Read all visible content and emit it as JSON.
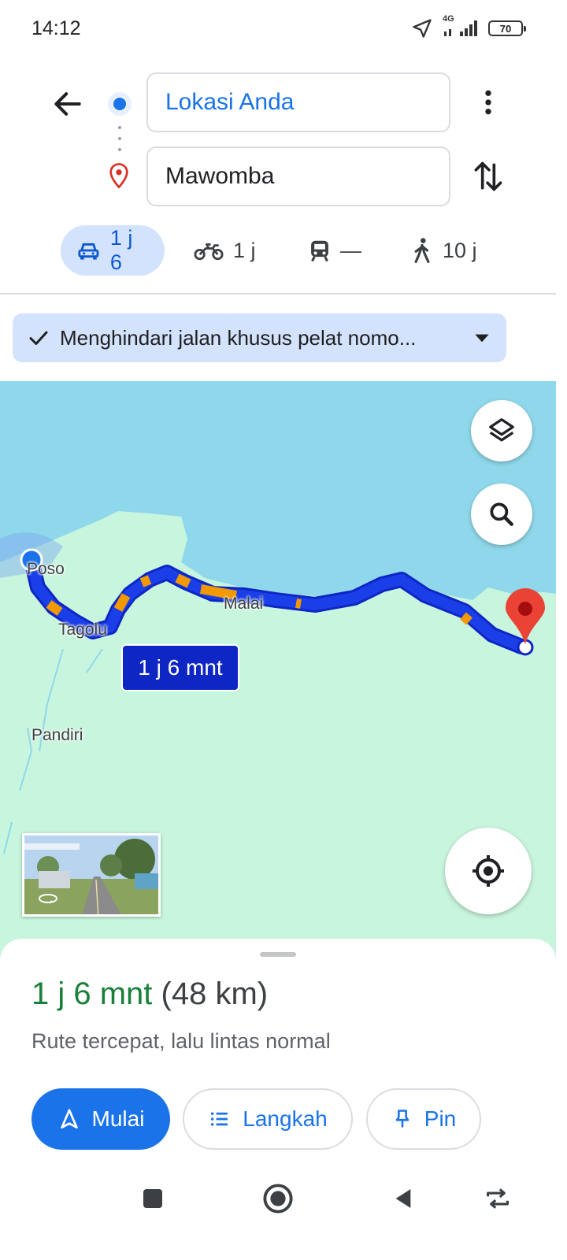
{
  "status_bar": {
    "time": "14:12",
    "network": "4G",
    "battery": "70"
  },
  "directions": {
    "origin": "Lokasi Anda",
    "destination": "Mawomba"
  },
  "travel_modes": [
    {
      "mode": "car",
      "icon": "car-icon",
      "time": "1 j 6",
      "active": true
    },
    {
      "mode": "motorcycle",
      "icon": "motorcycle-icon",
      "time": "1 j"
    },
    {
      "mode": "transit",
      "icon": "train-icon",
      "time": "—"
    },
    {
      "mode": "walk",
      "icon": "walk-icon",
      "time": "10 j"
    }
  ],
  "filter_chip": {
    "label": "Menghindari jalan khusus pelat nomo..."
  },
  "map": {
    "labels": {
      "poso": "Poso",
      "tagolu": "Tagolu",
      "malai": "Malai",
      "pandiri": "Pandiri"
    },
    "duration_badge": "1 j 6 mnt",
    "colors": {
      "water": "#8fd8eb",
      "land": "#c8f5dd",
      "route": "#1a3fe8",
      "traffic": "#f29900",
      "destination_pin": "#ea4335"
    }
  },
  "sheet": {
    "duration": "1 j 6 mnt",
    "distance": "(48 km)",
    "description": "Rute tercepat, lalu lintas normal",
    "start_button": "Mulai",
    "steps_button": "Langkah",
    "pin_button": "Pin"
  },
  "colors": {
    "primary": "#1a73e8",
    "chip_bg": "#d3e3fd",
    "duration_green": "#188038"
  }
}
